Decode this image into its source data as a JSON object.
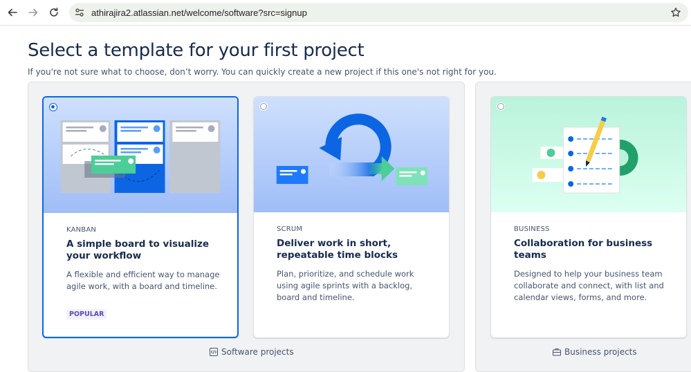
{
  "browser": {
    "url": "athirajira2.atlassian.net/welcome/software?src=signup"
  },
  "page": {
    "title": "Select a template for your first project",
    "subtitle": "If you're not sure what to choose, don’t worry. You can quickly create a new project if this one's not right for you."
  },
  "groups": {
    "software": {
      "label": "Software projects",
      "cards": [
        {
          "category": "KANBAN",
          "title": "A simple board to visualize your workflow",
          "description": "A flexible and efficient way to manage agile work, with a board and timeline.",
          "badge": "POPULAR",
          "selected": true
        },
        {
          "category": "SCRUM",
          "title": "Deliver work in short, repeatable time blocks",
          "description": "Plan, prioritize, and schedule work using agile sprints with a backlog, board and timeline.",
          "selected": false
        }
      ]
    },
    "business": {
      "label": "Business projects",
      "cards": [
        {
          "category": "BUSINESS",
          "title": "Collaboration for business teams",
          "description": "Designed to help your business team collaborate and connect, with list and calendar views, forms, and more.",
          "selected": false
        }
      ]
    }
  },
  "icons": {
    "back": "arrow-left-icon",
    "forward": "arrow-right-icon",
    "reload": "reload-icon",
    "site_settings": "site-settings-icon",
    "bookmark": "star-icon",
    "software": "code-icon",
    "business": "briefcase-icon"
  },
  "colors": {
    "accent": "#0c66e4",
    "heading": "#172b4d",
    "body_text": "#44546f",
    "popular_badge_bg": "#f3f0ff",
    "popular_badge_text": "#5e4db2"
  }
}
